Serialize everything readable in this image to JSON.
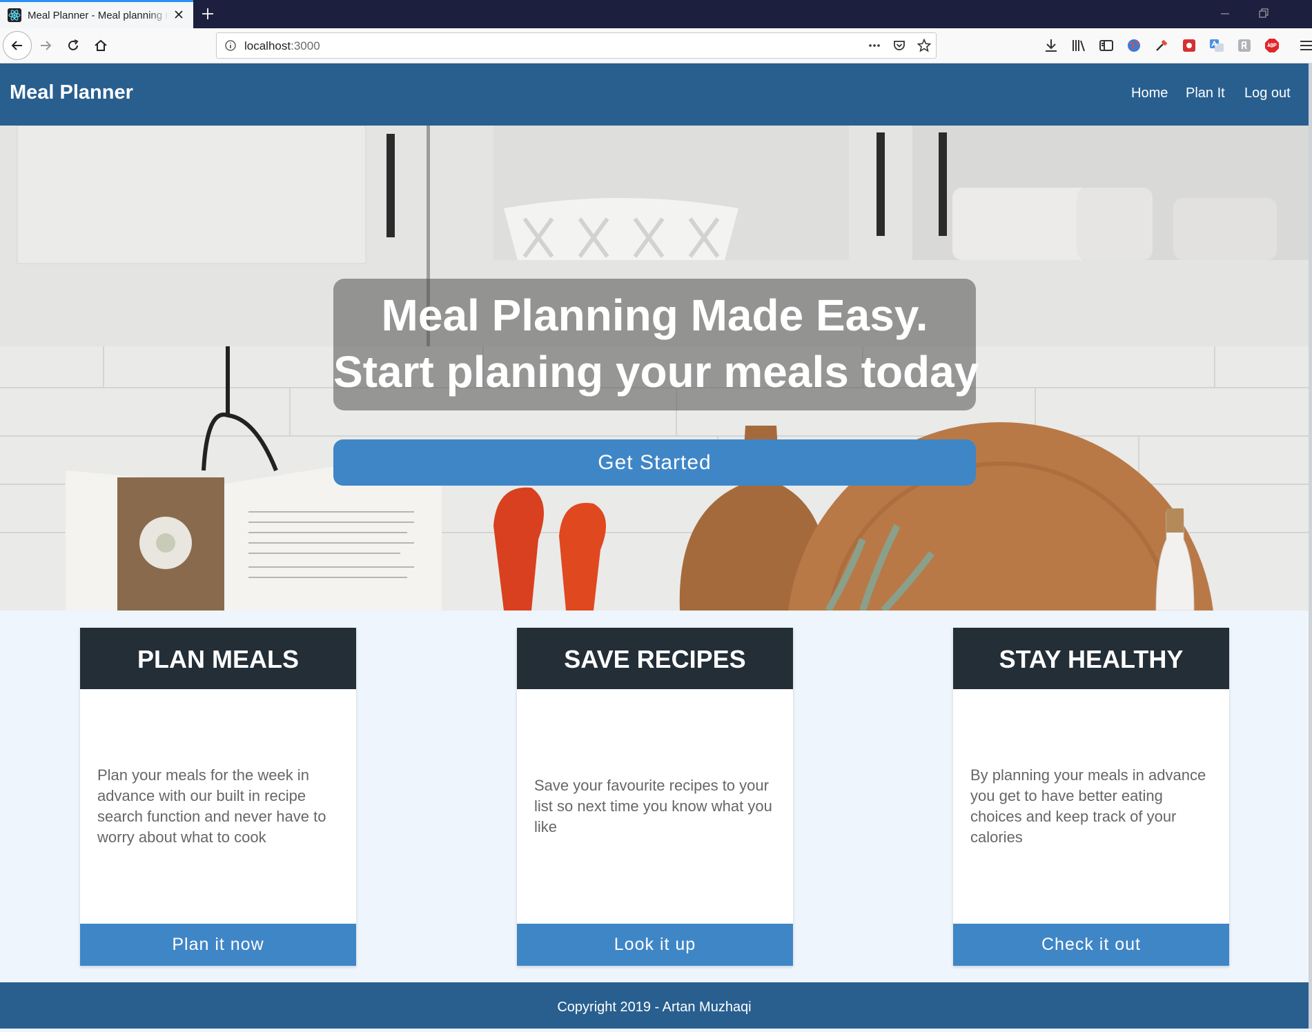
{
  "browser": {
    "tab_title": "Meal Planner - Meal planning made easy",
    "url_host": "localhost",
    "url_port": ":3000"
  },
  "header": {
    "brand": "Meal Planner",
    "nav": [
      "Home",
      "Plan It",
      "Log out"
    ]
  },
  "hero": {
    "title_line1": "Meal Planning Made Easy.",
    "title_line2": "Start planing your meals today",
    "cta_label": "Get Started"
  },
  "cards": [
    {
      "title": "PLAN MEALS",
      "text": "Plan your meals for the week in advance with our built in recipe search function and never have to worry about what to cook",
      "button": "Plan it now"
    },
    {
      "title": "SAVE RECIPES",
      "text": "Save your favourite recipes to your list so next time you know what you like",
      "button": "Look it up"
    },
    {
      "title": "STAY HEALTHY",
      "text": "By planning your meals in advance you get to have better eating choices and keep track of your calories",
      "button": "Check it out"
    }
  ],
  "footer": {
    "copyright": "Copyright 2019 - Artan Muzhaqi"
  },
  "colors": {
    "header_blue": "#285f8f",
    "button_blue": "#3f86c7",
    "card_header": "#242e37",
    "page_bg": "#eef5fc"
  }
}
